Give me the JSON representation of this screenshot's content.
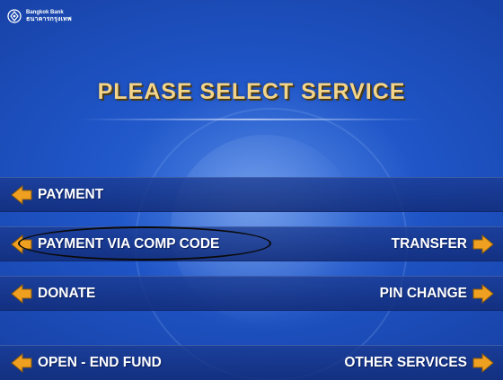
{
  "bank": {
    "name_en": "Bangkok Bank",
    "name_th": "ธนาคารกรุงเทพ",
    "logo_icon": "bank-logo-icon"
  },
  "screen": {
    "title": "PLEASE SELECT SERVICE"
  },
  "options": {
    "payment": {
      "label": "PAYMENT",
      "icon": "left-arrow-icon"
    },
    "payment_comp_code": {
      "label": "PAYMENT VIA COMP CODE",
      "icon": "left-arrow-icon",
      "highlighted": true
    },
    "transfer": {
      "label": "TRANSFER",
      "icon": "right-arrow-icon"
    },
    "donate": {
      "label": "DONATE",
      "icon": "left-arrow-icon"
    },
    "pin_change": {
      "label": "PIN CHANGE",
      "icon": "right-arrow-icon"
    },
    "open_end_fund": {
      "label": "OPEN - END FUND",
      "icon": "left-arrow-icon"
    },
    "other_services": {
      "label": "OTHER SERVICES",
      "icon": "right-arrow-icon"
    }
  },
  "colors": {
    "background": "#1f55c7",
    "title": "#f2d48a",
    "arrow": "#f0a020",
    "highlight_ring": "#0a0a0a"
  }
}
